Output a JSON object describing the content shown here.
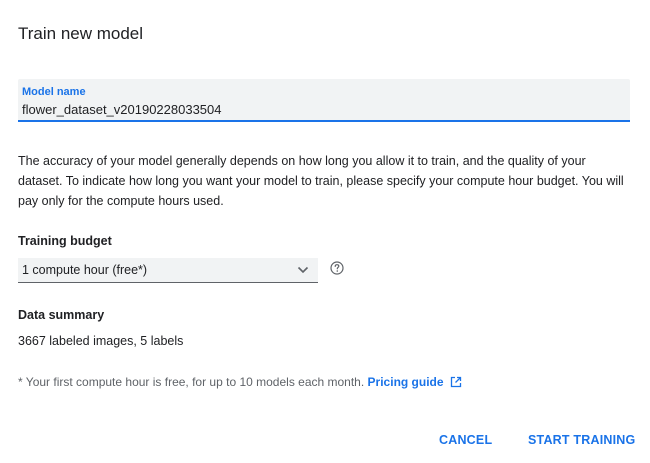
{
  "dialog": {
    "title": "Train new model"
  },
  "model_name": {
    "label": "Model name",
    "value": "flower_dataset_v20190228033504"
  },
  "description": "The accuracy of your model generally depends on how long you allow it to train, and the quality of your dataset. To indicate how long you want your model to train, please specify your compute hour budget. You will pay only for the compute hours used.",
  "training_budget": {
    "heading": "Training budget",
    "selected": "1 compute hour (free*)",
    "help_icon": "help-circle-icon",
    "chevron_icon": "chevron-down-icon"
  },
  "data_summary": {
    "heading": "Data summary",
    "text": "3667 labeled images, 5 labels"
  },
  "footnote": {
    "text": "* Your first compute hour is free, for up to 10 models each month.",
    "link_label": "Pricing guide",
    "link_icon": "open-in-new-icon"
  },
  "actions": {
    "cancel_label": "CANCEL",
    "start_label": "START TRAINING"
  },
  "colors": {
    "accent": "#1a73e8",
    "text": "#202124",
    "muted": "#5f6368",
    "field_bg": "#f1f3f4"
  }
}
